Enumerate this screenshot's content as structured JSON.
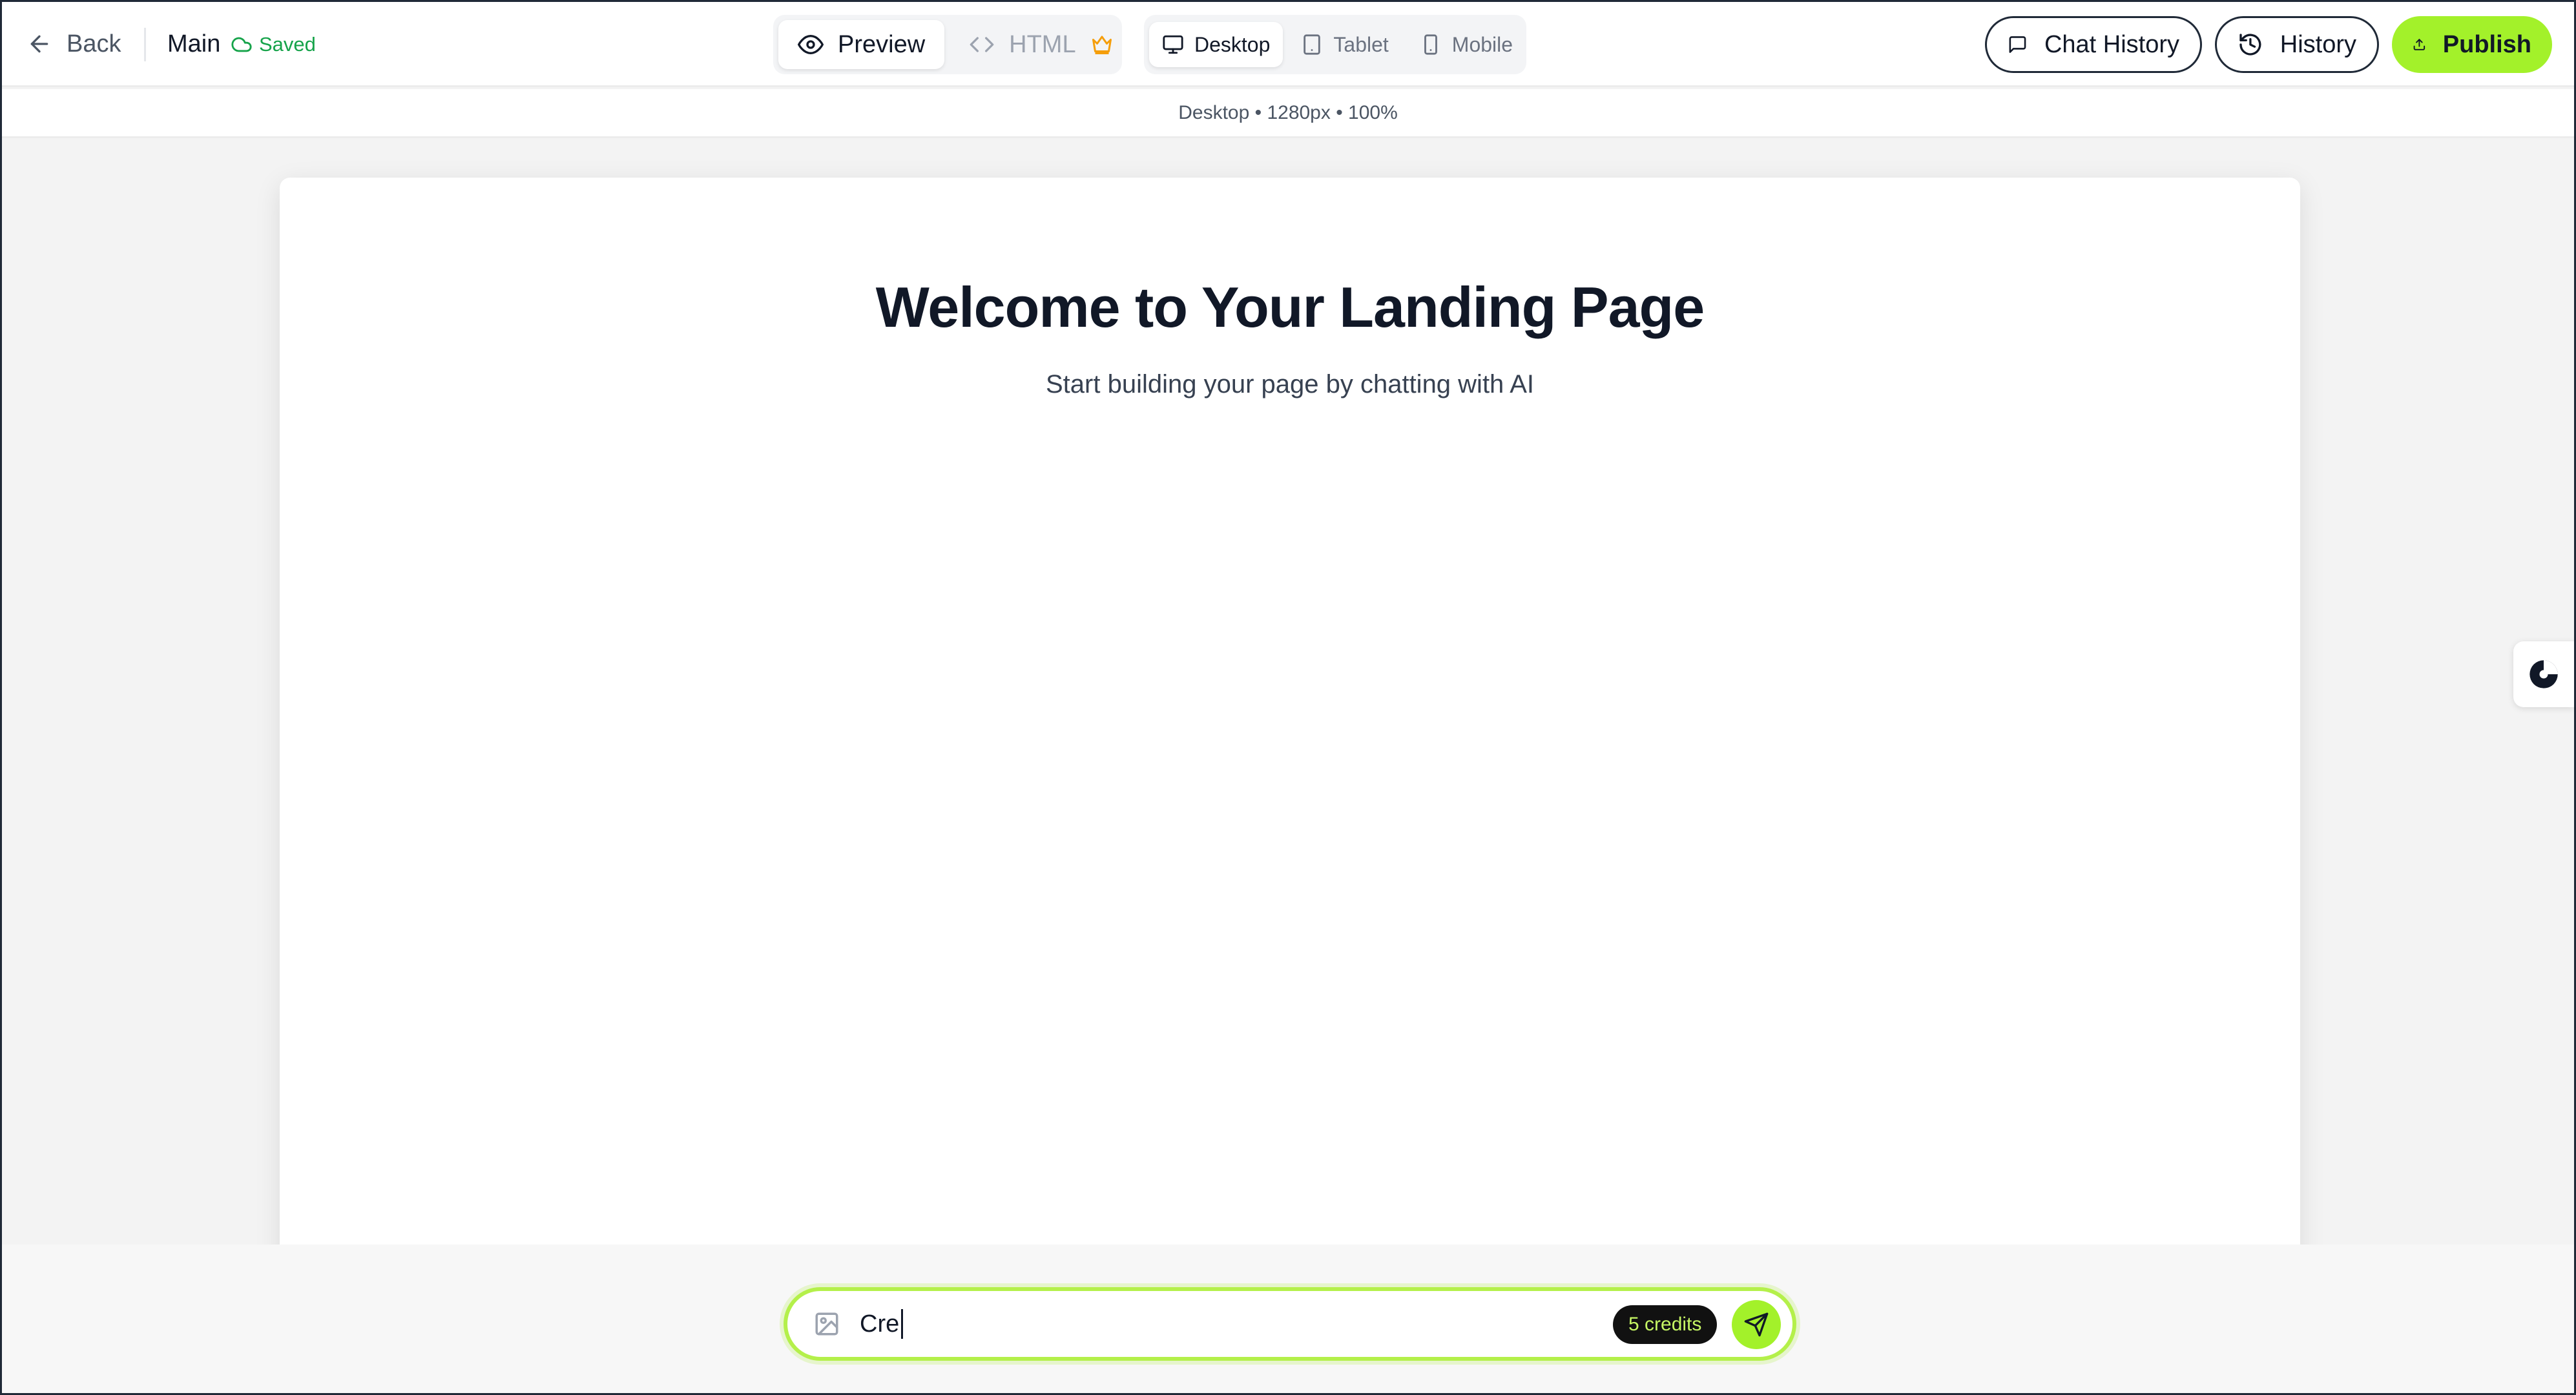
{
  "header": {
    "back_label": "Back",
    "page_title": "Main",
    "save_status": "Saved"
  },
  "view_toggle": {
    "preview_label": "Preview",
    "html_label": "HTML",
    "active": "Preview"
  },
  "device_toggle": {
    "desktop_label": "Desktop",
    "tablet_label": "Tablet",
    "mobile_label": "Mobile",
    "active": "Desktop"
  },
  "actions": {
    "chat_history_label": "Chat History",
    "history_label": "History",
    "publish_label": "Publish"
  },
  "viewport_info": "Desktop • 1280px • 100%",
  "canvas": {
    "title": "Welcome to Your Landing Page",
    "subtitle": "Start building your page by chatting with AI"
  },
  "chat": {
    "input_value": "Cre",
    "credits_label": "5 credits"
  },
  "colors": {
    "accent": "#a3f12a",
    "saved": "#16a34a",
    "premium_crown": "#f59e0b"
  },
  "icons": {
    "back": "arrow-left-icon",
    "saved": "cloud-icon",
    "preview": "eye-icon",
    "html": "code-icon",
    "crown": "crown-icon",
    "desktop": "monitor-icon",
    "tablet": "tablet-icon",
    "mobile": "phone-icon",
    "chat_history": "message-square-icon",
    "history": "history-icon",
    "publish": "upload-icon",
    "image": "image-icon",
    "send": "send-icon"
  }
}
